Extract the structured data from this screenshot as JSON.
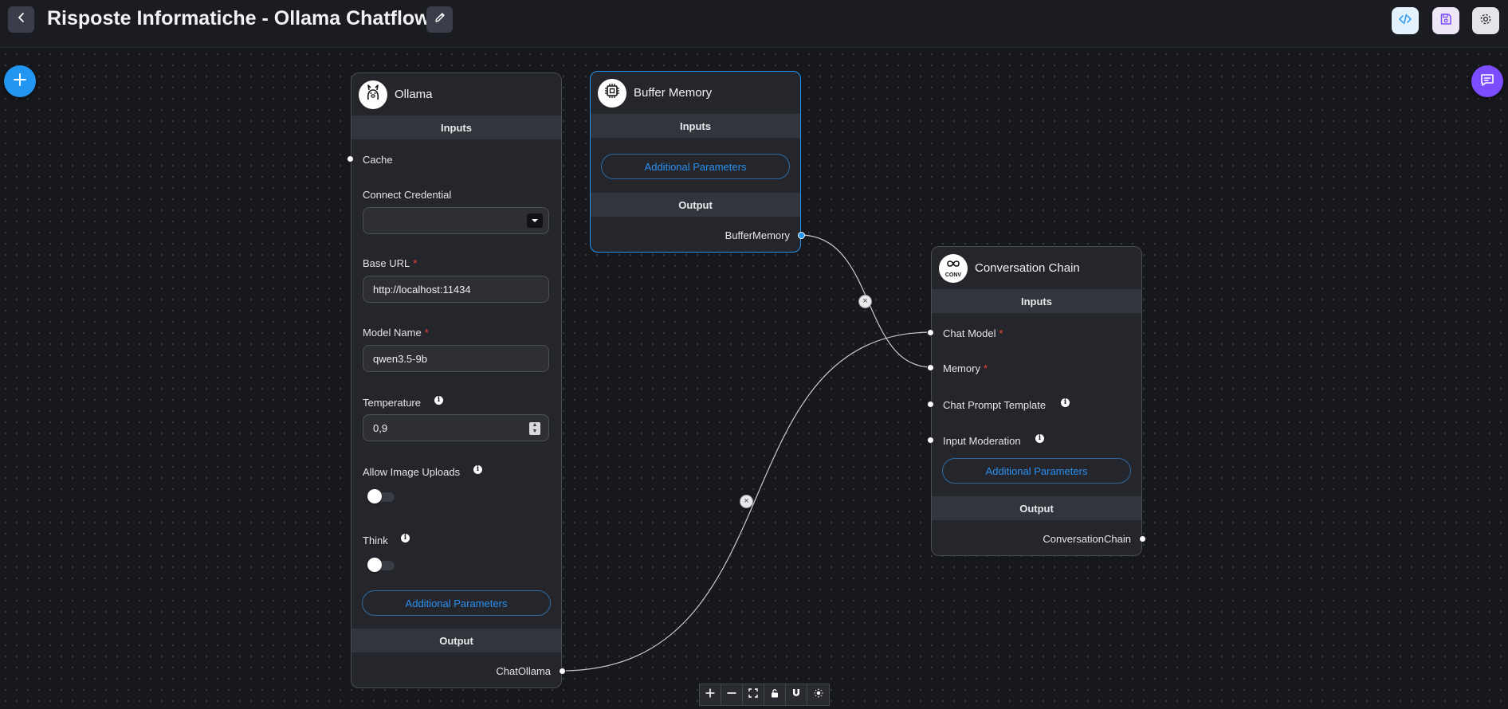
{
  "header": {
    "title": "Risposte Informatiche - Ollama Chatflow"
  },
  "nodes": {
    "ollama": {
      "title": "Ollama",
      "inputs_label": "Inputs",
      "cache_label": "Cache",
      "credential_label": "Connect Credential",
      "credential_value": "",
      "base_url_label": "Base URL",
      "base_url_value": "http://localhost:11434",
      "model_name_label": "Model Name",
      "model_name_value": "qwen3.5-9b",
      "temperature_label": "Temperature",
      "temperature_value": "0,9",
      "image_uploads_label": "Allow Image Uploads",
      "image_uploads_enabled": false,
      "think_label": "Think",
      "think_enabled": false,
      "additional_params_label": "Additional Parameters",
      "output_label": "Output",
      "output_name": "ChatOllama"
    },
    "buffer_memory": {
      "title": "Buffer Memory",
      "inputs_label": "Inputs",
      "additional_params_label": "Additional Parameters",
      "output_label": "Output",
      "output_name": "BufferMemory"
    },
    "conversation_chain": {
      "title": "Conversation Chain",
      "avatar_text": "CONV",
      "inputs_label": "Inputs",
      "chat_model_label": "Chat Model",
      "memory_label": "Memory",
      "prompt_template_label": "Chat Prompt Template",
      "input_moderation_label": "Input Moderation",
      "additional_params_label": "Additional Parameters",
      "output_label": "Output",
      "output_name": "ConversationChain"
    }
  },
  "required_marker": "*",
  "info_marker": "i",
  "edge_delete_glyph": "×",
  "colors": {
    "accent_blue": "#2196f3",
    "chat_purple": "#7c4dff",
    "required_red": "#f44336",
    "canvas_bg": "#17181c",
    "node_bg": "#25262b"
  },
  "icons": {
    "back": "chevron-left-icon",
    "edit": "pencil-icon",
    "code": "code-icon",
    "save": "save-icon",
    "settings": "gear-icon",
    "add": "plus-icon",
    "chat": "chat-icon",
    "controls": [
      "zoom-in-icon",
      "zoom-out-icon",
      "fit-view-icon",
      "lock-icon",
      "magnet-icon",
      "theme-sun-icon"
    ]
  }
}
